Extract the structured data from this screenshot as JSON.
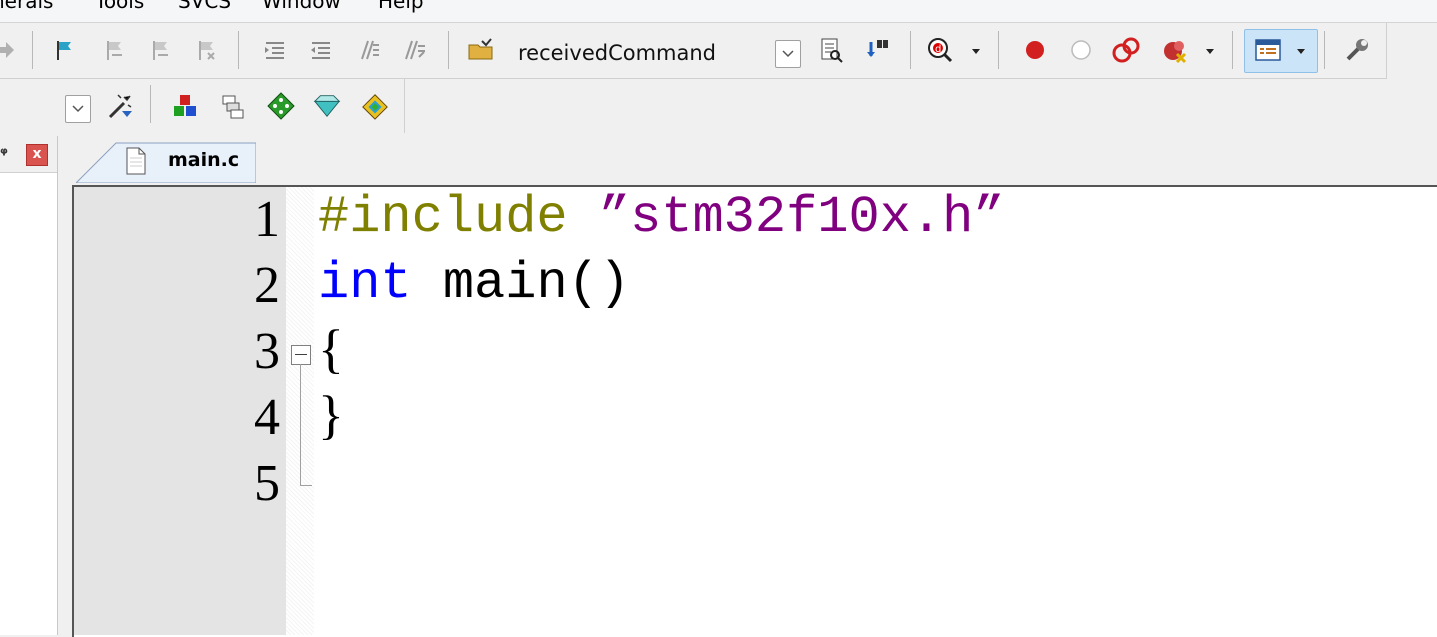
{
  "menubar": {
    "items": [
      "herals",
      "Tools",
      "SVCS",
      "Window",
      "Help"
    ]
  },
  "toolbar": {
    "target_combo_value": "receivedCommand"
  },
  "left_panel": {
    "close_label": "x"
  },
  "editor": {
    "tab_label": "main.c",
    "line_numbers": [
      "1",
      "2",
      "3",
      "4",
      "5"
    ],
    "lines": [
      {
        "pp": "#include ",
        "str": "”stm32f10x.h”"
      },
      {
        "type": "int",
        "rest": " main()"
      },
      {
        "text": "{"
      },
      {
        "text": "}"
      },
      {
        "text": ""
      }
    ]
  },
  "colors": {
    "preprocessor": "#808000",
    "string": "#800080",
    "keyword": "#0000ff",
    "selected_button_bg": "#cce4f7"
  },
  "icons": [
    "arrow-right-icon",
    "flag-icon",
    "bookmark-prev-icon",
    "bookmark-next-icon",
    "bookmark-clear-icon",
    "indent-icon",
    "unindent-icon",
    "comment-icon",
    "uncomment-icon",
    "open-folder-icon",
    "combo-dropdown-icon",
    "find-in-files-icon",
    "incremental-find-icon",
    "debug-session-icon",
    "breakpoint-icon",
    "breakpoint-disabled-icon",
    "breakpoint-kill-icon",
    "breakpoint-clear-icon",
    "window-layout-icon",
    "configure-icon",
    "target-options-icon",
    "manage-run-env-icon",
    "file-extensions-icon",
    "translate-icon",
    "build-icon",
    "rebuild-icon",
    "batch-build-icon"
  ]
}
